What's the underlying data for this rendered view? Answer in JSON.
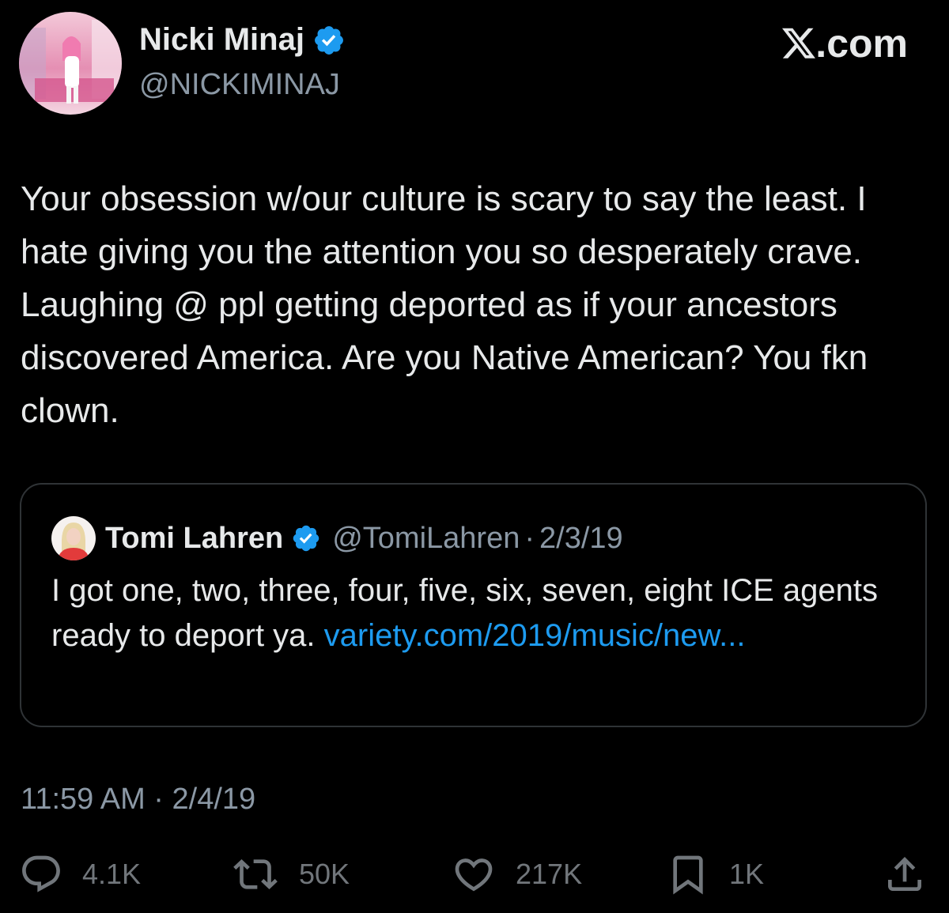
{
  "author": {
    "name": "Nicki Minaj",
    "handle": "@NICKIMINAJ",
    "verified": true
  },
  "brand": {
    "label": ".com"
  },
  "tweet": {
    "text": "Your obsession w/our culture is scary to say the least. I hate giving you the attention you so desperately crave. Laughing @ ppl getting deported as if your ancestors discovered America. Are you Native American? You fkn clown."
  },
  "quote": {
    "name": "Tomi Lahren",
    "handle": "@TomiLahren",
    "separator": "·",
    "date": "2/3/19",
    "text": "I got one, two, three, four, five, six, seven, eight ICE agents ready to deport ya. ",
    "link": "variety.com/2019/music/new..."
  },
  "meta": {
    "time": "11:59 AM",
    "separator": "·",
    "date": "2/4/19"
  },
  "actions": {
    "replies": "4.1K",
    "reposts": "50K",
    "likes": "217K",
    "bookmarks": "1K"
  },
  "colors": {
    "background": "#000000",
    "text": "#e7e9ea",
    "secondary": "#8b98a5",
    "icon": "#71767b",
    "link": "#1d9bf0",
    "verified": "#1d9bf0",
    "border": "#2f3336"
  }
}
